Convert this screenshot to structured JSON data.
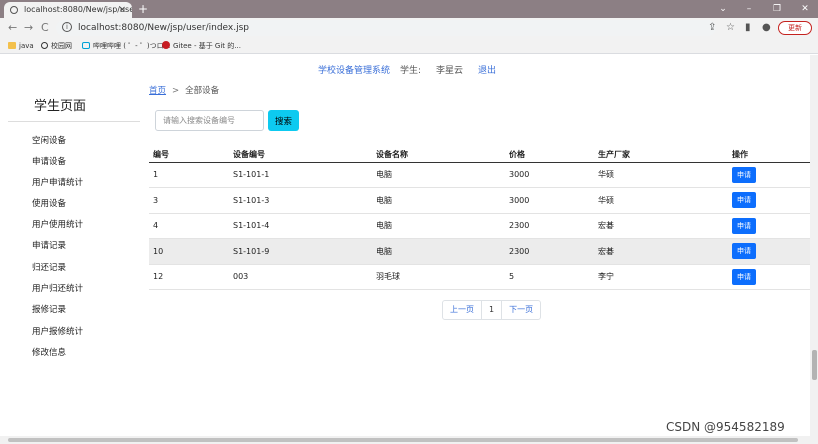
{
  "browser": {
    "tab_title": "localhost:8080/New/jsp/user/",
    "tab_close": "×",
    "new_tab": "+",
    "url": "localhost:8080/New/jsp/user/index.jsp",
    "update_label": "更新",
    "window_controls": [
      "⌄",
      "–",
      "❐",
      "✕"
    ],
    "nav": {
      "back": "←",
      "forward": "→",
      "reload": "C"
    },
    "toolbar_icons": [
      "⇪",
      "☆",
      "▮",
      "●"
    ],
    "bookmarks": [
      {
        "label": "java",
        "icon": "folder-icon"
      },
      {
        "label": "校园网",
        "icon": "globe-icon"
      },
      {
        "label": "哔哩哔哩 ( ゜- ゜)つロ...",
        "icon": "bilibili-icon"
      },
      {
        "label": "Gitee - 基于 Git 的...",
        "icon": "gitee-icon"
      }
    ]
  },
  "header": {
    "brand": "学校设备管理系统",
    "user_label": "学生:",
    "user_name": "李星云",
    "logout": "退出"
  },
  "sidebar": {
    "title": "学生页面",
    "items": [
      "空闲设备",
      "申请设备",
      "用户申请统计",
      "使用设备",
      "用户使用统计",
      "申请记录",
      "归还记录",
      "用户归还统计",
      "报修记录",
      "用户报修统计",
      "修改信息"
    ]
  },
  "breadcrumb": {
    "home": "首页",
    "separator": ">",
    "current": "全部设备"
  },
  "search": {
    "placeholder": "请输入搜索设备编号",
    "button": "搜索"
  },
  "table": {
    "headers": [
      "编号",
      "设备编号",
      "设备名称",
      "价格",
      "生产厂家",
      "操作"
    ],
    "rows": [
      [
        "1",
        "S1-101-1",
        "电脑",
        "3000",
        "华硕",
        "申请"
      ],
      [
        "3",
        "S1-101-3",
        "电脑",
        "3000",
        "华硕",
        "申请"
      ],
      [
        "4",
        "S1-101-4",
        "电脑",
        "2300",
        "宏碁",
        "申请"
      ],
      [
        "10",
        "S1-101-9",
        "电脑",
        "2300",
        "宏碁",
        "申请"
      ],
      [
        "12",
        "003",
        "羽毛球",
        "5",
        "李宁",
        "申请"
      ]
    ]
  },
  "pager": {
    "prev": "上一页",
    "current": "1",
    "next": "下一页"
  },
  "watermark": "CSDN @954582189"
}
